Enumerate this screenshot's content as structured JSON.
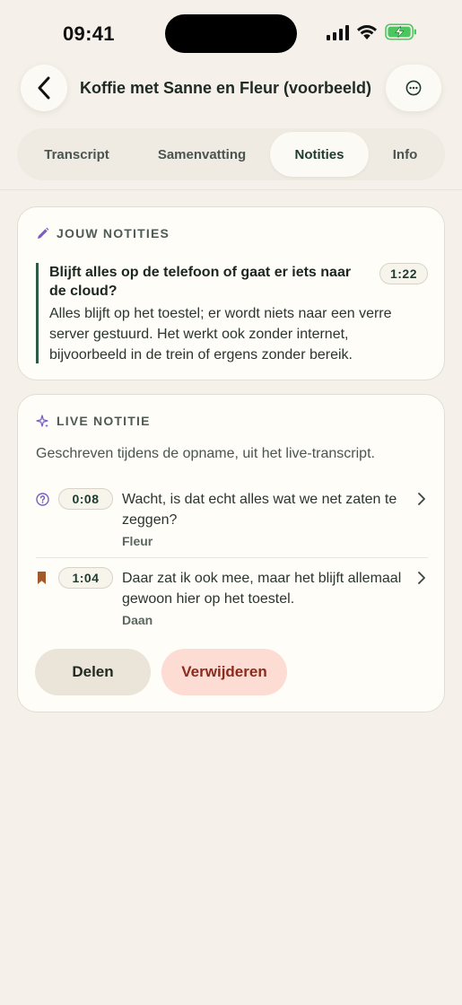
{
  "status_bar": {
    "time": "09:41"
  },
  "header": {
    "title": "Koffie met Sanne en Fleur (voorbeeld)"
  },
  "tabs": [
    {
      "label": "Transcript",
      "active": false
    },
    {
      "label": "Samenvatting",
      "active": false
    },
    {
      "label": "Notities",
      "active": true
    },
    {
      "label": "Info",
      "active": false
    }
  ],
  "your_notes": {
    "heading": "JOUW NOTITIES",
    "note": {
      "title": "Blijft alles op de telefoon of gaat er iets naar de cloud?",
      "time": "1:22",
      "body": "Alles blijft op het toestel; er wordt niets naar een verre server gestuurd. Het werkt ook zonder internet, bijvoorbeeld in de trein of ergens zonder bereik."
    }
  },
  "live_note": {
    "heading": "LIVE NOTITIE",
    "subtitle": "Geschreven tijdens de opname, uit het live-transcript.",
    "items": [
      {
        "icon": "question-circle-icon",
        "time": "0:08",
        "text": "Wacht, is dat echt alles wat we net zaten te zeggen?",
        "speaker": "Fleur"
      },
      {
        "icon": "bookmark-icon",
        "time": "1:04",
        "text": "Daar zat ik ook mee, maar het blijft allemaal gewoon hier op het toestel.",
        "speaker": "Daan"
      }
    ],
    "share_label": "Delen",
    "delete_label": "Verwijderen"
  },
  "colors": {
    "background": "#f5f1ea",
    "card": "#fefdf8",
    "accent_green": "#1e3b30",
    "accent_purple": "#7b5cc4",
    "bookmark_orange": "#a4582a",
    "delete_bg": "#fddcd4",
    "delete_text": "#8c2a1c",
    "battery_green": "#4cc75f"
  }
}
